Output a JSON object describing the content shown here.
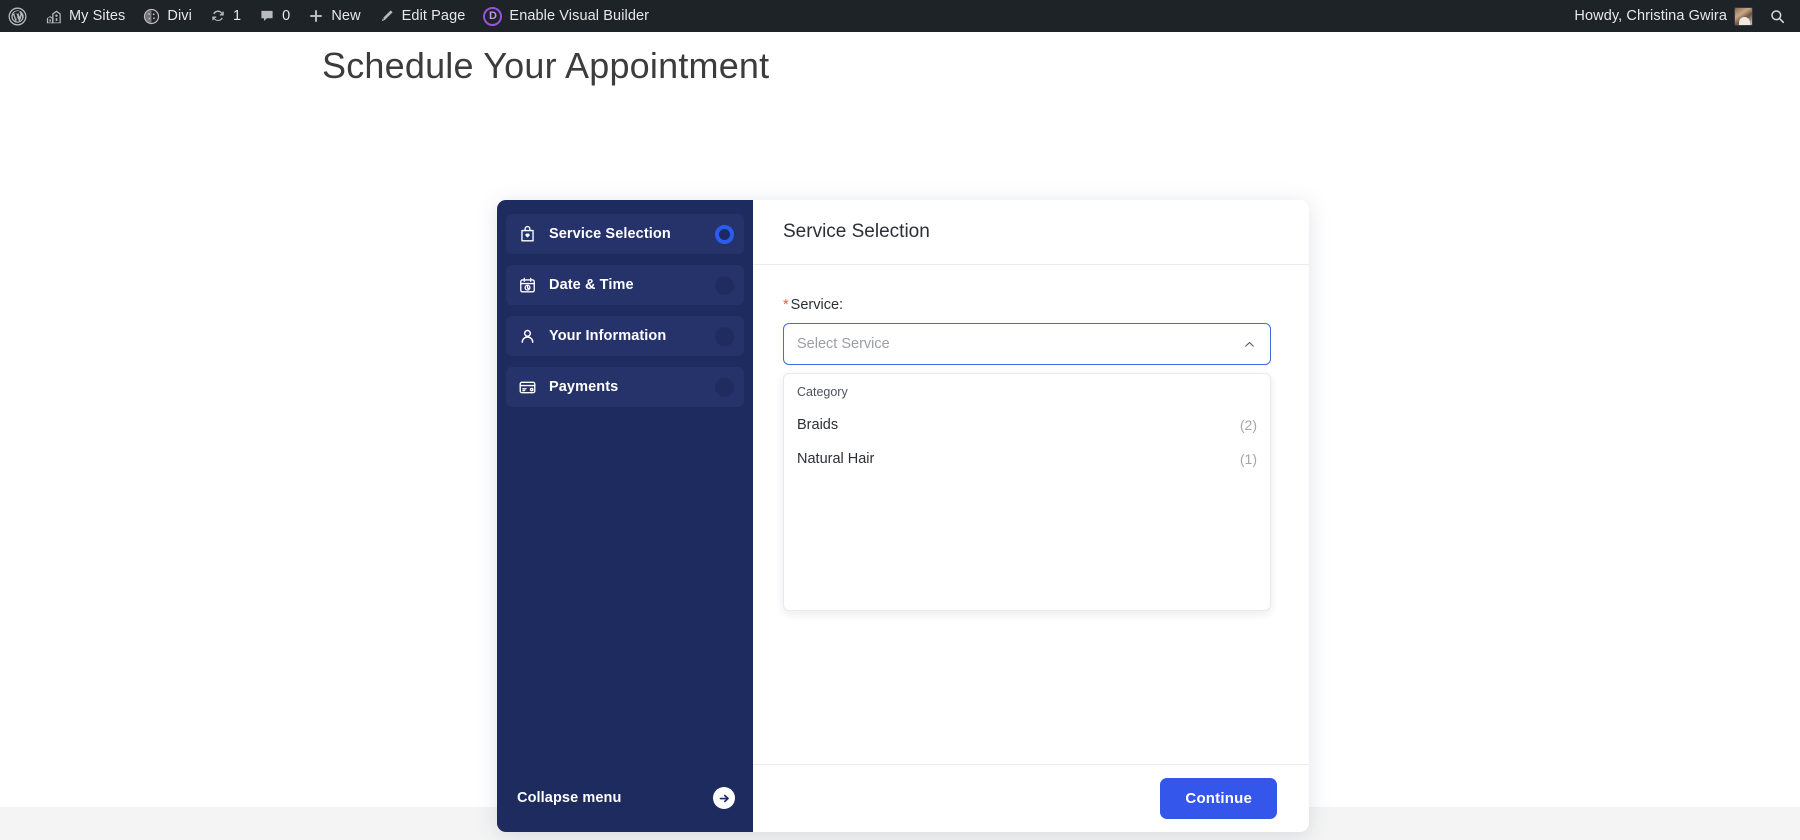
{
  "adminbar": {
    "left_items": [
      {
        "icon": "wordpress-logo-icon",
        "label": ""
      },
      {
        "icon": "my-sites-icon",
        "label": "My Sites"
      },
      {
        "icon": "divi-icon",
        "label": "Divi"
      },
      {
        "icon": "updates-icon",
        "label": "1"
      },
      {
        "icon": "comments-icon",
        "label": "0"
      },
      {
        "icon": "new-content-icon",
        "label": "New"
      },
      {
        "icon": "edit-page-icon",
        "label": "Edit Page"
      },
      {
        "icon": "divi-badge-icon",
        "label": "Enable Visual Builder"
      }
    ],
    "divi_badge_letter": "D",
    "howdy": "Howdy, Christina Gwira",
    "search_icon": "search-icon",
    "background_color": "#1d2327"
  },
  "page": {
    "title": "Schedule Your Appointment",
    "background_color": "#ffffff"
  },
  "booking": {
    "sidebar": {
      "background_color": "#1e2b5e",
      "steps": [
        {
          "label": "Service Selection",
          "icon": "shopping-bag-heart-icon",
          "active": true
        },
        {
          "label": "Date & Time",
          "icon": "calendar-clock-icon",
          "active": false
        },
        {
          "label": "Your Information",
          "icon": "person-icon",
          "active": false
        },
        {
          "label": "Payments",
          "icon": "credit-card-icon",
          "active": false
        }
      ],
      "collapse": {
        "label": "Collapse menu",
        "icon": "arrow-right-circle-icon"
      },
      "active_indicator_color": "#2a5cf0"
    },
    "panel": {
      "title": "Service Selection",
      "field": {
        "required_marker": "*",
        "label": "Service:",
        "placeholder": "Select Service",
        "value": "",
        "chevron_icon": "chevron-up-icon",
        "border_color": "#3f6ae0"
      },
      "dropdown": {
        "group_header": "Category",
        "options": [
          {
            "label": "Braids",
            "count": "(2)"
          },
          {
            "label": "Natural Hair",
            "count": "(1)"
          }
        ]
      },
      "footer": {
        "continue_label": "Continue",
        "continue_color": "#3556eb"
      }
    }
  }
}
